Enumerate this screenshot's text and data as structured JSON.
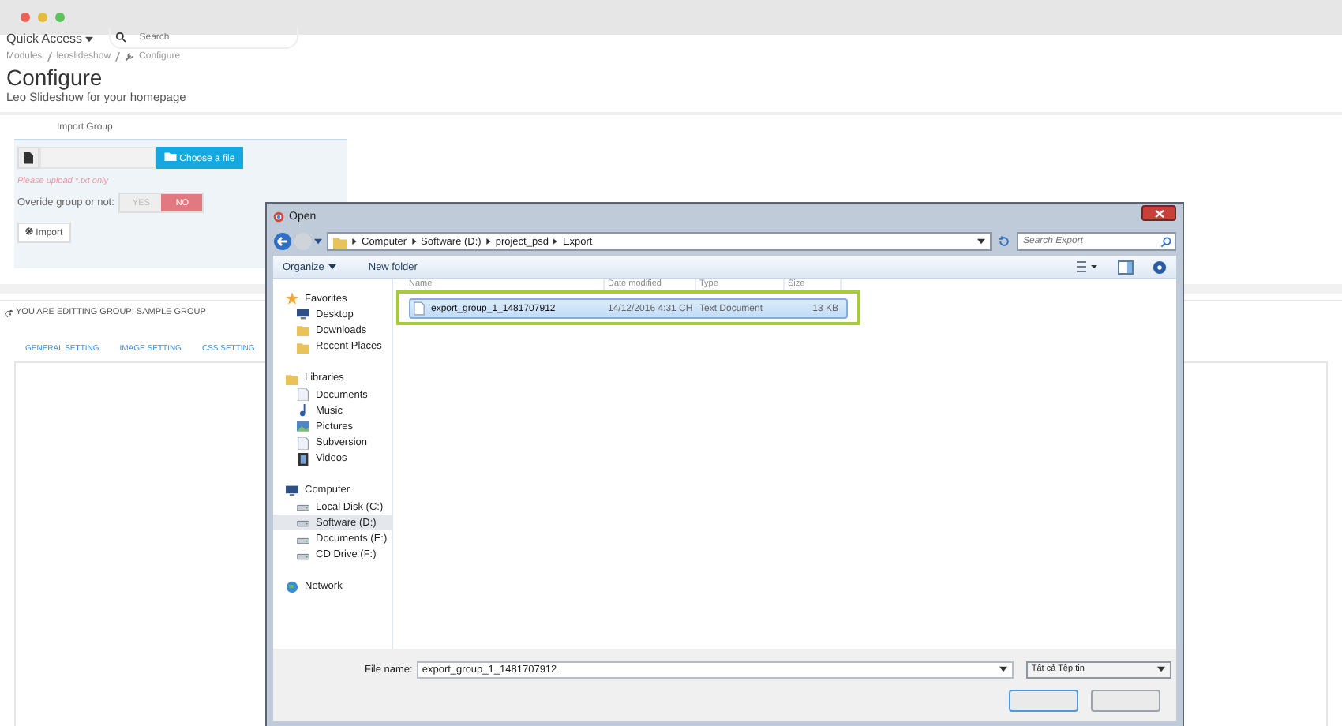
{
  "browser": {
    "quick_access": "Quick Access",
    "search": {
      "placeholder": "Search"
    }
  },
  "breadcrumb": [
    "Modules",
    "leoslideshow",
    "Configure"
  ],
  "page_title": "Configure",
  "subtitle": "Leo Slideshow for your homepage",
  "import_panel": {
    "heading": "Import Group",
    "choose_button": "Choose a file",
    "hint": "Please upload *.txt only",
    "override_label": "Overide group or not:",
    "toggle": [
      {
        "label": "YES",
        "selected": false
      },
      {
        "label": "NO",
        "selected": true
      }
    ],
    "import_button": "Import"
  },
  "editing_header": "YOU ARE EDITTING GROUP: SAMPLE GROUP",
  "tabs": [
    {
      "label": "GENERAL SETTING"
    },
    {
      "label": "IMAGE SETTING"
    },
    {
      "label": "CSS SETTING"
    }
  ],
  "dialog": {
    "title": "Open",
    "path": [
      "Computer",
      "Software (D:)",
      "project_psd",
      "Export"
    ],
    "search": {
      "placeholder": "Search Export"
    },
    "toolbar": [
      {
        "label": "Organize",
        "kind": "menu"
      },
      {
        "label": "New folder",
        "kind": "plain"
      }
    ],
    "nav": [
      {
        "label": "Favorites",
        "kind": "star",
        "selected": false,
        "children": [
          {
            "label": "Desktop",
            "kind": "monitor",
            "selected": false
          },
          {
            "label": "Downloads",
            "kind": "folder",
            "selected": false
          },
          {
            "label": "Recent Places",
            "kind": "folder",
            "selected": false
          }
        ]
      },
      {
        "label": "Libraries",
        "kind": "folder",
        "selected": false,
        "children": [
          {
            "label": "Documents",
            "kind": "document",
            "selected": false
          },
          {
            "label": "Music",
            "kind": "note",
            "selected": false
          },
          {
            "label": "Pictures",
            "kind": "image",
            "selected": false
          },
          {
            "label": "Subversion",
            "kind": "document",
            "selected": false
          },
          {
            "label": "Videos",
            "kind": "film",
            "selected": false
          }
        ]
      },
      {
        "label": "Computer",
        "kind": "monitor",
        "selected": false,
        "children": [
          {
            "label": "Local Disk (C:)",
            "kind": "drive",
            "selected": false
          },
          {
            "label": "Software (D:)",
            "kind": "drive",
            "selected": true
          },
          {
            "label": "Documents (E:)",
            "kind": "drive",
            "selected": false
          },
          {
            "label": "CD Drive (F:)",
            "kind": "drive",
            "selected": false
          }
        ]
      },
      {
        "label": "Network",
        "kind": "globe",
        "selected": false
      }
    ],
    "columns": [
      "Name",
      "Date modified",
      "Type",
      "Size"
    ],
    "files": [
      {
        "name": "export_group_1_1481707912",
        "date": "14/12/2016 4:31 CH",
        "type": "Text Document",
        "size": "13 KB",
        "selected": true
      }
    ],
    "file_name_label": "File name:",
    "file_name": "export_group_1_1481707912",
    "file_type": "Tất cả Tệp tin"
  }
}
